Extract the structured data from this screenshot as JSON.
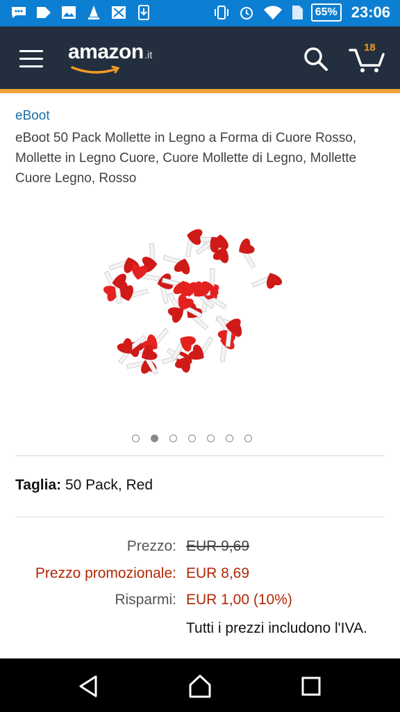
{
  "status_bar": {
    "battery": "65%",
    "time": "23:06"
  },
  "header": {
    "logo_text": "amazon",
    "logo_tld": ".it",
    "cart_count": "18",
    "colors": {
      "background": "#232f3e",
      "accent": "#f0a23a",
      "cart_badge": "#f29b24"
    }
  },
  "product": {
    "brand": "eBoot",
    "title": "eBoot 50 Pack Mollette in Legno a Forma di Cuore Rosso, Mollette in Legno Cuore, Cuore Mollette di Legno, Mollette Cuore Legno, Rosso",
    "image_dots_count": 7,
    "image_dot_active": 2,
    "size_label": "Taglia:",
    "size_value": "50 Pack, Red"
  },
  "pricing": {
    "price_label": "Prezzo:",
    "price_value": "EUR 9,69",
    "promo_label": "Prezzo promozionale:",
    "promo_value": "EUR 8,69",
    "savings_label": "Risparmi:",
    "savings_value": "EUR 1,00 (10%)",
    "vat_note": "Tutti i prezzi includono l'IVA.",
    "colors": {
      "promo": "#b12704"
    }
  }
}
